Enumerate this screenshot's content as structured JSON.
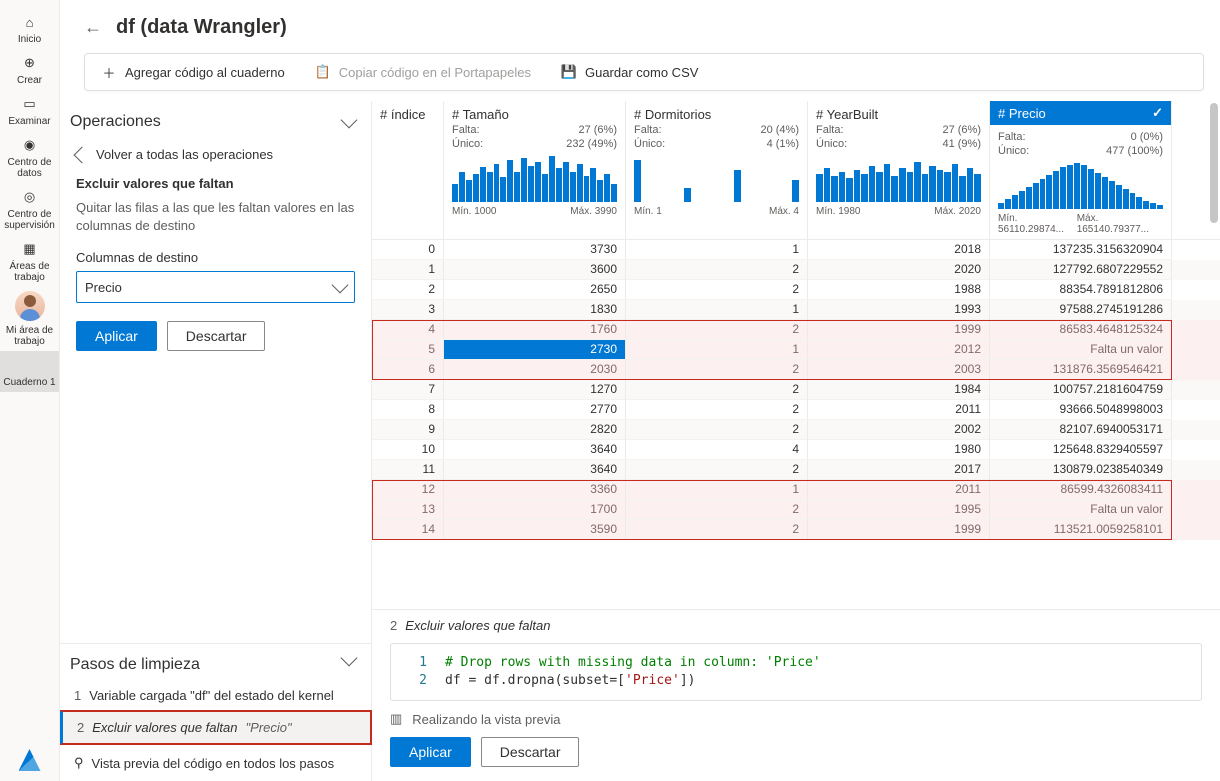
{
  "nav": {
    "items": [
      {
        "icon": "home",
        "label": "Inicio"
      },
      {
        "icon": "plus-circle",
        "label": "Crear"
      },
      {
        "icon": "folder",
        "label": "Examinar"
      },
      {
        "icon": "database",
        "label": "Centro de datos"
      },
      {
        "icon": "monitor",
        "label": "Centro de supervisión"
      },
      {
        "icon": "workspace",
        "label": "Áreas de trabajo"
      },
      {
        "icon": "avatar",
        "label": "Mi área de trabajo"
      },
      {
        "icon": "notebook",
        "label": "Cuaderno 1"
      }
    ]
  },
  "header": {
    "title": "df (data Wrangler)"
  },
  "toolbar": {
    "add": "Agregar código al cuaderno",
    "copy": "Copiar código en el Portapapeles",
    "save": "Guardar como CSV"
  },
  "ops": {
    "panel_title": "Operaciones",
    "back": "Volver a todas las operaciones",
    "op_title": "Excluir valores que faltan",
    "op_desc": "Quitar las filas a las que les faltan valores en las columnas de destino",
    "target_label": "Columnas de destino",
    "target_value": "Precio",
    "apply": "Aplicar",
    "discard": "Descartar"
  },
  "steps": {
    "title": "Pasos de limpieza",
    "s1_num": "1",
    "s1_text": "Variable cargada \"df\" del estado del kernel",
    "s2_num": "2",
    "s2_text": "Excluir valores que faltan",
    "s2_detail": "\"Precio\"",
    "preview_all": "Vista previa del código en todos los pasos"
  },
  "columns": [
    {
      "key": "indice",
      "name": "# índice",
      "falta": "",
      "unico": "",
      "min": "",
      "max": "",
      "spark": []
    },
    {
      "key": "tamano",
      "name": "# Tamaño",
      "falta": "27 (6%)",
      "unico": "232 (49%)",
      "min": "Mín. 1000",
      "max": "Máx. 3990",
      "spark": [
        18,
        30,
        22,
        28,
        35,
        30,
        38,
        25,
        42,
        30,
        44,
        36,
        40,
        28,
        46,
        34,
        40,
        30,
        38,
        26,
        34,
        22,
        28,
        18
      ]
    },
    {
      "key": "dorm",
      "name": "# Dormitorios",
      "falta": "20 (4%)",
      "unico": "4 (1%)",
      "min": "Mín. 1",
      "max": "Máx. 4",
      "spark": [
        42,
        0,
        0,
        0,
        0,
        0,
        14,
        0,
        0,
        0,
        0,
        0,
        32,
        0,
        0,
        0,
        0,
        0,
        0,
        22
      ]
    },
    {
      "key": "year",
      "name": "# YearBuilt",
      "falta": "27 (6%)",
      "unico": "41 (9%)",
      "min": "Mín. 1980",
      "max": "Máx. 2020",
      "spark": [
        28,
        34,
        26,
        30,
        24,
        32,
        28,
        36,
        30,
        38,
        26,
        34,
        30,
        40,
        28,
        36,
        32,
        30,
        38,
        26,
        34,
        28
      ]
    },
    {
      "key": "precio",
      "name": "# Precio",
      "falta": "0 (0%)",
      "unico": "477 (100%)",
      "min": "Mín. 56110.29874...",
      "max": "Máx. 165140.79377...",
      "spark": [
        6,
        10,
        14,
        18,
        22,
        26,
        30,
        34,
        38,
        42,
        44,
        46,
        44,
        40,
        36,
        32,
        28,
        24,
        20,
        16,
        12,
        8,
        6,
        4
      ]
    }
  ],
  "stats_labels": {
    "falta": "Falta:",
    "unico": "Único:"
  },
  "rows": [
    {
      "i": "0",
      "t": "3730",
      "d": "1",
      "y": "2018",
      "p": "137235.3156320904",
      "del": false
    },
    {
      "i": "1",
      "t": "3600",
      "d": "2",
      "y": "2020",
      "p": "127792.6807229552",
      "del": false
    },
    {
      "i": "2",
      "t": "2650",
      "d": "2",
      "y": "1988",
      "p": "88354.7891812806",
      "del": false
    },
    {
      "i": "3",
      "t": "1830",
      "d": "1",
      "y": "1993",
      "p": "97588.2745191286",
      "del": false
    },
    {
      "i": "4",
      "t": "1760",
      "d": "2",
      "y": "1999",
      "p": "86583.4648125324",
      "del": true
    },
    {
      "i": "5",
      "t": "2730",
      "d": "1",
      "y": "2012",
      "p": "Falta un valor",
      "del": true,
      "sel": true
    },
    {
      "i": "6",
      "t": "2030",
      "d": "2",
      "y": "2003",
      "p": "131876.3569546421",
      "del": true
    },
    {
      "i": "7",
      "t": "1270",
      "d": "2",
      "y": "1984",
      "p": "100757.2181604759",
      "del": false
    },
    {
      "i": "8",
      "t": "2770",
      "d": "2",
      "y": "2011",
      "p": "93666.5048998003",
      "del": false
    },
    {
      "i": "9",
      "t": "2820",
      "d": "2",
      "y": "2002",
      "p": "82107.6940053171",
      "del": false
    },
    {
      "i": "10",
      "t": "3640",
      "d": "4",
      "y": "1980",
      "p": "125648.8329405597",
      "del": false
    },
    {
      "i": "11",
      "t": "3640",
      "d": "2",
      "y": "2017",
      "p": "130879.0238540349",
      "del": false
    },
    {
      "i": "12",
      "t": "3360",
      "d": "1",
      "y": "2011",
      "p": "86599.4326083411",
      "del": true
    },
    {
      "i": "13",
      "t": "1700",
      "d": "2",
      "y": "1995",
      "p": "Falta un valor",
      "del": true
    },
    {
      "i": "14",
      "t": "3590",
      "d": "2",
      "y": "1999",
      "p": "113521.0059258101",
      "del": true
    }
  ],
  "code": {
    "title_num": "2",
    "title_text": "Excluir valores que faltan",
    "line1_comment": "# Drop rows with missing data in column: 'Price'",
    "line2_a": "df = df.dropna(subset=[",
    "line2_str": "'Price'",
    "line2_b": "])",
    "status": "Realizando la vista previa",
    "apply": "Aplicar",
    "discard": "Descartar"
  },
  "chart_data": {
    "type": "table",
    "title": "df (data Wrangler)",
    "columns": [
      "índice",
      "Tamaño",
      "Dormitorios",
      "YearBuilt",
      "Precio"
    ],
    "column_stats": {
      "Tamaño": {
        "missing": "27 (6%)",
        "unique": "232 (49%)",
        "min": 1000,
        "max": 3990
      },
      "Dormitorios": {
        "missing": "20 (4%)",
        "unique": "4 (1%)",
        "min": 1,
        "max": 4
      },
      "YearBuilt": {
        "missing": "27 (6%)",
        "unique": "41 (9%)",
        "min": 1980,
        "max": 2020
      },
      "Precio": {
        "missing": "0 (0%)",
        "unique": "477 (100%)",
        "min": 56110.29874,
        "max": 165140.79377
      }
    },
    "rows": [
      [
        0,
        3730,
        1,
        2018,
        137235.3156320904
      ],
      [
        1,
        3600,
        2,
        2020,
        127792.6807229552
      ],
      [
        2,
        2650,
        2,
        1988,
        88354.7891812806
      ],
      [
        3,
        1830,
        1,
        1993,
        97588.2745191286
      ],
      [
        4,
        1760,
        2,
        1999,
        86583.4648125324
      ],
      [
        5,
        2730,
        1,
        2012,
        null
      ],
      [
        6,
        2030,
        2,
        2003,
        131876.3569546421
      ],
      [
        7,
        1270,
        2,
        1984,
        100757.2181604759
      ],
      [
        8,
        2770,
        2,
        2011,
        93666.5048998003
      ],
      [
        9,
        2820,
        2,
        2002,
        82107.6940053171
      ],
      [
        10,
        3640,
        4,
        1980,
        125648.8329405597
      ],
      [
        11,
        3640,
        2,
        2017,
        130879.0238540349
      ],
      [
        12,
        3360,
        1,
        2011,
        86599.4326083411
      ],
      [
        13,
        1700,
        2,
        1995,
        null
      ],
      [
        14,
        3590,
        2,
        1999,
        113521.0059258101
      ]
    ]
  }
}
